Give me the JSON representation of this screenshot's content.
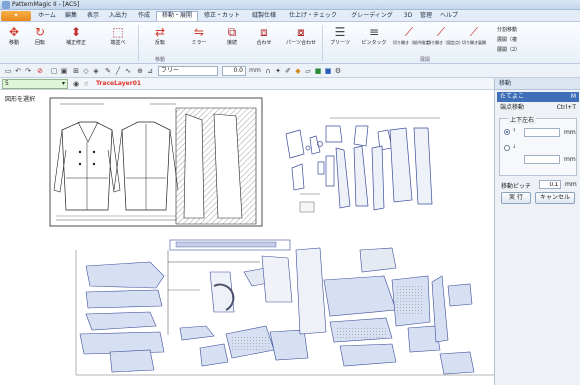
{
  "window": {
    "title": "PatternMagic II - [ACS]"
  },
  "menu": {
    "file_label": "▾",
    "items": [
      {
        "label": "ホーム",
        "active": false
      },
      {
        "label": "編集",
        "active": false
      },
      {
        "label": "表示",
        "active": false
      },
      {
        "label": "入出力",
        "active": false
      },
      {
        "label": "作成",
        "active": false
      },
      {
        "label": "移動・展開",
        "active": true
      },
      {
        "label": "修正・カット",
        "active": false
      },
      {
        "label": "縫製仕様",
        "active": false
      },
      {
        "label": "仕上げ・チェック",
        "active": false
      },
      {
        "label": "グレーディング",
        "active": false
      },
      {
        "label": "3D",
        "active": false
      },
      {
        "label": "管理",
        "active": false
      },
      {
        "label": "ヘルプ",
        "active": false
      }
    ]
  },
  "ribbon": {
    "buttons": [
      {
        "label": "移動",
        "icon": "move-icon"
      },
      {
        "label": "回転",
        "icon": "rotate-icon"
      },
      {
        "label": "補正修正",
        "icon": "correct-icon"
      },
      {
        "label": "端並べ",
        "icon": "align-icon"
      },
      {
        "label": "反転",
        "icon": "flip-icon"
      },
      {
        "label": "ミラー",
        "icon": "mirror-icon"
      },
      {
        "label": "接続",
        "icon": "connect-icon"
      },
      {
        "label": "合わせ",
        "icon": "match-icon"
      },
      {
        "label": "パーツ合わせ",
        "icon": "parts-match-icon"
      },
      {
        "label": "プリーツ",
        "icon": "pleat-icon"
      },
      {
        "label": "ピンタック",
        "icon": "pintuck-icon"
      },
      {
        "label": "切り開き（縦/A指定）",
        "icon": "slash-spread-icon"
      },
      {
        "label": "切り開き（固定点）",
        "icon": "slash-fixed-icon"
      },
      {
        "label": "切り開き展開",
        "icon": "slash-expand-icon"
      }
    ],
    "side_items": [
      "分割移動",
      "展開（複",
      "展開（2）"
    ],
    "groups": [
      "移動",
      "展開"
    ]
  },
  "toolbar": {
    "line_type": "フリー",
    "width_value": "0.0",
    "width_unit": "mm"
  },
  "layer": {
    "current": "5",
    "name": "TraceLayer01"
  },
  "canvas": {
    "select_label": "図形を選択"
  },
  "panel": {
    "title": "移動",
    "commands": [
      {
        "label": "たてよこ",
        "shortcut": "M",
        "selected": true
      },
      {
        "label": "端点移動",
        "shortcut": "Ctrl+T",
        "selected": false
      }
    ],
    "direction_title": "上下左右",
    "dx_value": "",
    "dy_value": "",
    "unit": "mm",
    "pitch_label": "移動ピッチ",
    "pitch_value": "0.1",
    "pitch_unit": "mm",
    "run_label": "実 行",
    "cancel_label": "キャンセル"
  }
}
